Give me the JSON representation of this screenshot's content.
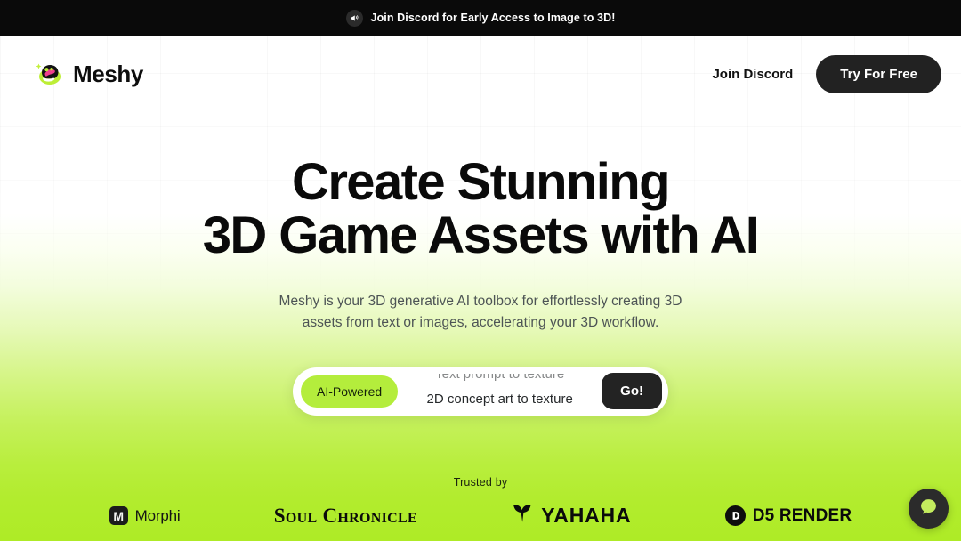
{
  "banner": {
    "icon": "megaphone-icon",
    "text": "Join Discord for Early Access to Image to 3D!"
  },
  "header": {
    "logo_text": "Meshy",
    "logo_mark": "meshy-mascot-icon",
    "nav_link": "Join Discord",
    "cta_label": "Try For Free"
  },
  "hero": {
    "headline_line1": "Create Stunning",
    "headline_line2": "3D Game Assets with AI",
    "subtitle": "Meshy is your 3D generative AI toolbox for effortlessly creating 3D assets from text or images, accelerating your 3D workflow."
  },
  "prompt_bar": {
    "pill_label": "AI-Powered",
    "rotating_outgoing": "Text prompt to texture",
    "rotating_current": "2D concept art to texture",
    "go_label": "Go!"
  },
  "trusted": {
    "label": "Trusted by",
    "brands": [
      {
        "name": "Morphi",
        "mark": "M"
      },
      {
        "name": "Soul Chronicle"
      },
      {
        "name": "YAHAHA"
      },
      {
        "name": "D5 RENDER"
      }
    ]
  },
  "chat": {
    "icon": "chat-bubble-icon"
  },
  "colors": {
    "accent_green": "#b4ed3c",
    "bg_green": "#aeeb26",
    "dark": "#222222",
    "banner_bg": "#0a0a0a"
  }
}
